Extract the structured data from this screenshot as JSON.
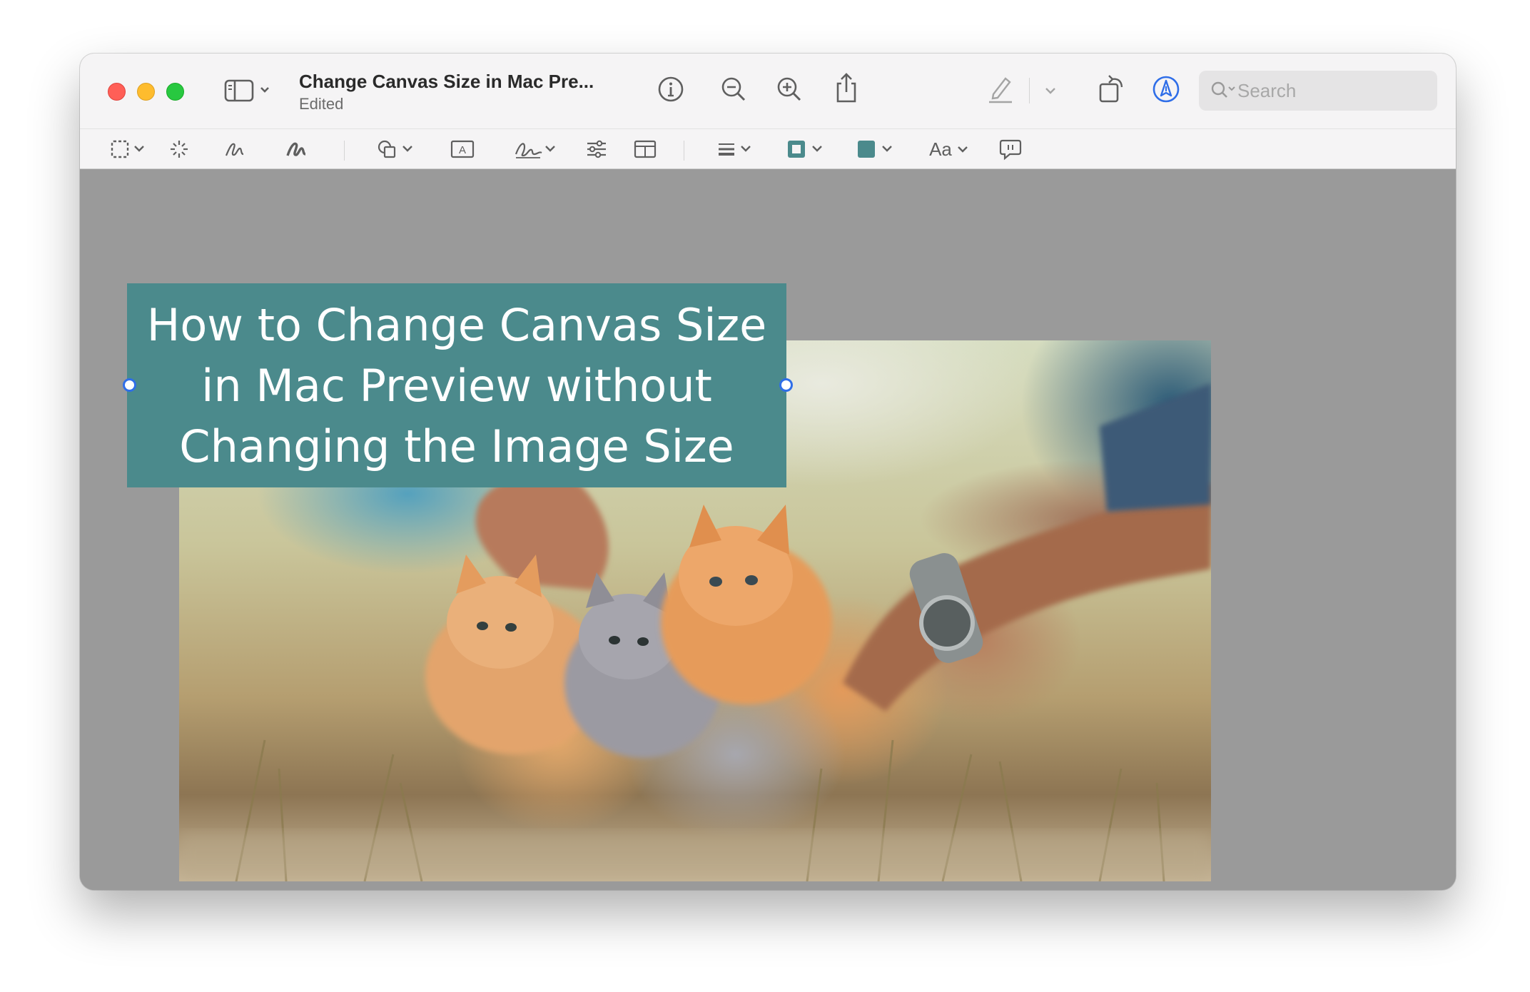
{
  "window": {
    "title": "Change Canvas Size in Mac Pre...",
    "subtitle": "Edited"
  },
  "search": {
    "placeholder": "Search"
  },
  "markup_toolbar": {
    "font_button_label": "Aa"
  },
  "canvas": {
    "text_box": {
      "text": "How to Change Canvas Size in Mac Preview without Changing the Image Size",
      "fill_color": "#4b8a8c",
      "text_color": "#ffffff"
    }
  },
  "colors": {
    "close": "#ff5f57",
    "minimize": "#febc2e",
    "zoom": "#28c840",
    "markup_accent": "#2f6ee8",
    "selection_handle": "#2f6ee8"
  }
}
